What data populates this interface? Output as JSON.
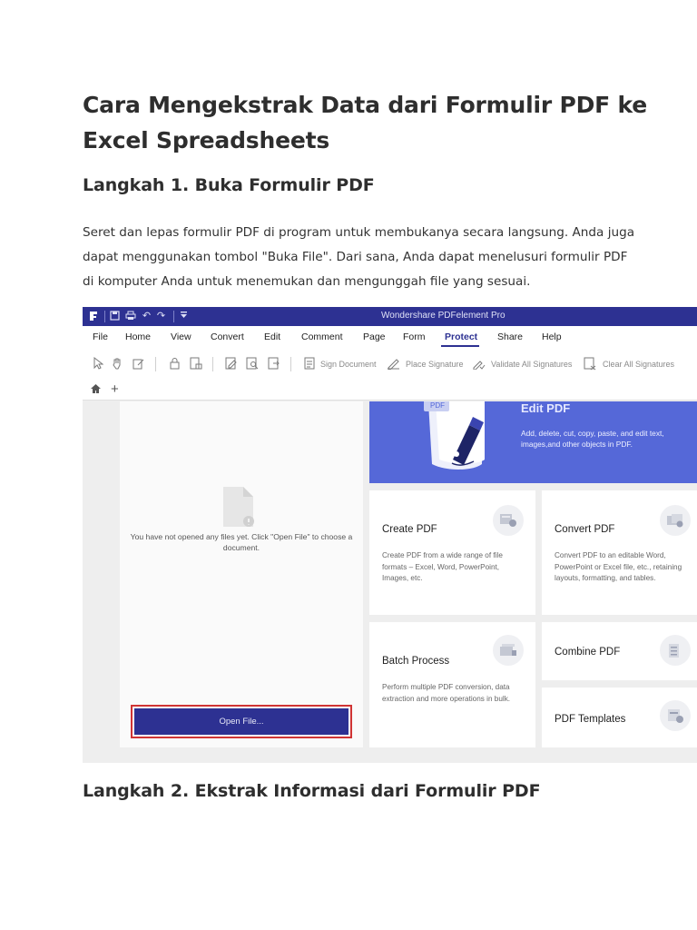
{
  "article": {
    "title": "Cara Mengekstrak Data dari Formulir PDF ke Excel Spreadsheets",
    "step1_heading": "Langkah 1. Buka Formulir PDF",
    "step1_body": "Seret dan lepas formulir PDF di program untuk membukanya secara langsung. Anda juga dapat menggunakan tombol \"Buka File\". Dari sana, Anda dapat menelusuri formulir PDF di komputer Anda untuk menemukan dan mengunggah file yang sesuai.",
    "step2_heading": "Langkah 2. Ekstrak Informasi dari Formulir PDF"
  },
  "app": {
    "window_title": "Wondershare PDFelement Pro",
    "accent_color": "#2d3192",
    "menu": [
      "File",
      "Home",
      "View",
      "Convert",
      "Edit",
      "Comment",
      "Page",
      "Form",
      "Protect",
      "Share",
      "Help"
    ],
    "active_menu": "Protect",
    "toolbar": {
      "sign_document": "Sign Document",
      "place_signature": "Place Signature",
      "validate_all": "Validate All Signatures",
      "clear_all": "Clear All Signatures"
    },
    "empty_message": "You have not opened any files yet. Click \"Open File\" to choose a document.",
    "open_file_button": "Open File...",
    "edit_card": {
      "title": "Edit PDF",
      "description": "Add, delete, cut, copy, paste, and edit text, images,and other objects in PDF.",
      "badge": "PDF"
    },
    "cards": {
      "create": {
        "title": "Create PDF",
        "description": "Create PDF from a wide range of file formats – Excel, Word, PowerPoint, Images, etc."
      },
      "convert": {
        "title": "Convert PDF",
        "description": "Convert PDF to an editable Word, PowerPoint or Excel file, etc., retaining layouts, formatting, and tables."
      },
      "batch": {
        "title": "Batch Process",
        "description": "Perform multiple PDF conversion, data extraction and more operations in bulk."
      },
      "combine": {
        "title": "Combine PDF"
      },
      "templates": {
        "title": "PDF Templates"
      }
    }
  }
}
